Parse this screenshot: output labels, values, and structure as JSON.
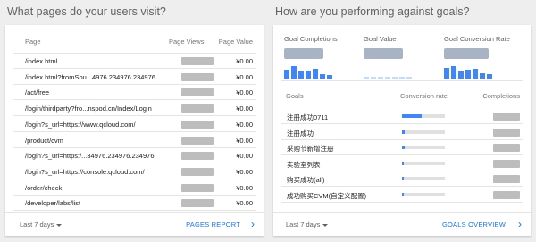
{
  "left": {
    "title": "What pages do your users visit?",
    "columns": {
      "page": "Page",
      "views": "Page Views",
      "value": "Page Value"
    },
    "rows": [
      {
        "page": "/index.html",
        "value": "¥0.00"
      },
      {
        "page": "/index.html?fromSou...4976.234976.234976",
        "value": "¥0.00"
      },
      {
        "page": "/act/free",
        "value": "¥0.00"
      },
      {
        "page": "/login/thirdparty?fro...nspod.cn/Index/Login",
        "value": "¥0.00"
      },
      {
        "page": "/login?s_url=https://www.qcloud.com/",
        "value": "¥0.00"
      },
      {
        "page": "/product/cvm",
        "value": "¥0.00"
      },
      {
        "page": "/login?s_url=https:/...34976.234976.234976",
        "value": "¥0.00"
      },
      {
        "page": "/login?s_url=https://console.qcloud.com/",
        "value": "¥0.00"
      },
      {
        "page": "/order/check",
        "value": "¥0.00"
      },
      {
        "page": "/developer/labs/list",
        "value": "¥0.00"
      }
    ],
    "footer": {
      "range": "Last 7 days",
      "link": "PAGES REPORT"
    }
  },
  "right": {
    "title": "How are you performing against goals?",
    "metrics": {
      "completions": "Goal Completions",
      "value": "Goal Value",
      "rate": "Goal Conversion Rate"
    },
    "columns": {
      "goals": "Goals",
      "rate": "Conversion rate",
      "completions": "Completions"
    },
    "goals": [
      {
        "name": "注册成功0711",
        "rate": 0.45
      },
      {
        "name": "注册成功",
        "rate": 0.06
      },
      {
        "name": "采购节新增注册",
        "rate": 0.06
      },
      {
        "name": "实验室列表",
        "rate": 0.05
      },
      {
        "name": "购买成功(all)",
        "rate": 0.05
      },
      {
        "name": "成功购买CVM(自定义配置)",
        "rate": 0.05
      }
    ],
    "footer": {
      "range": "Last 7 days",
      "link": "GOALS OVERVIEW"
    }
  },
  "colors": {
    "accent": "#4285f4",
    "link": "#1a73e8"
  },
  "icons": {
    "caret": "caret-down-icon",
    "chevron": "chevron-right-icon"
  }
}
